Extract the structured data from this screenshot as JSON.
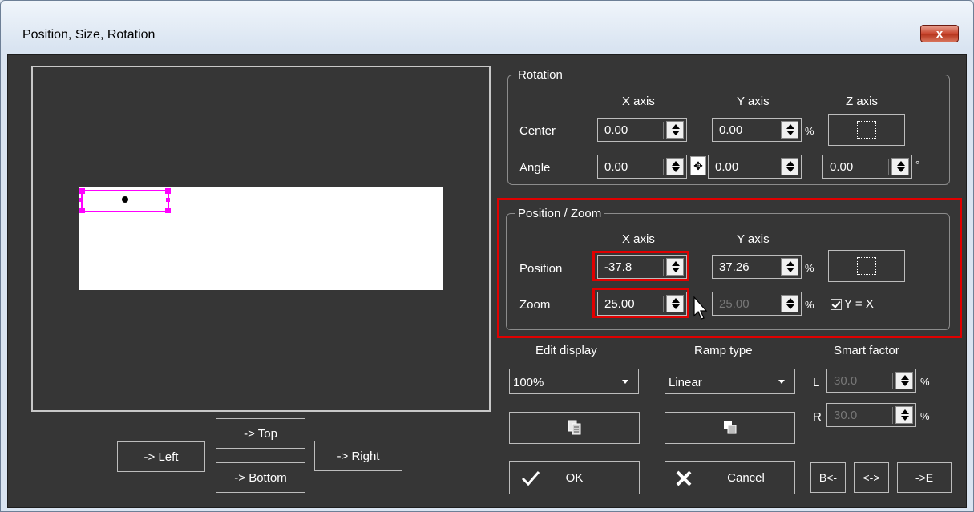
{
  "window": {
    "title": "Position, Size, Rotation",
    "close_symbol": "x"
  },
  "nav_buttons": {
    "left": "-> Left",
    "top": "-> Top",
    "bottom": "-> Bottom",
    "right": "-> Right"
  },
  "rotation": {
    "title": "Rotation",
    "headers": {
      "x": "X axis",
      "y": "Y axis",
      "z": "Z axis"
    },
    "center": {
      "label": "Center",
      "x": "0.00",
      "y": "0.00",
      "unit": "%"
    },
    "angle": {
      "label": "Angle",
      "x": "0.00",
      "y": "0.00",
      "z": "0.00",
      "unit": "°"
    }
  },
  "position_zoom": {
    "title": "Position / Zoom",
    "headers": {
      "x": "X axis",
      "y": "Y axis"
    },
    "position": {
      "label": "Position",
      "x": "-37.8",
      "y": "37.26",
      "unit": "%"
    },
    "zoom": {
      "label": "Zoom",
      "x": "25.00",
      "y": "25.00",
      "unit": "%"
    },
    "lock_label": "Y = X",
    "lock_checked": true
  },
  "edit_display": {
    "label": "Edit display",
    "value": "100%"
  },
  "ramp_type": {
    "label": "Ramp type",
    "value": "Linear"
  },
  "smart_factor": {
    "label": "Smart factor",
    "l_label": "L",
    "l_value": "30.0",
    "r_label": "R",
    "r_value": "30.0",
    "unit": "%"
  },
  "actions": {
    "ok": "OK",
    "cancel": "Cancel",
    "begin": "B<-",
    "both": "<->",
    "end": "->E"
  },
  "colors": {
    "highlight": "#e00000",
    "handle": "#ff00ff",
    "panel": "#363636"
  }
}
